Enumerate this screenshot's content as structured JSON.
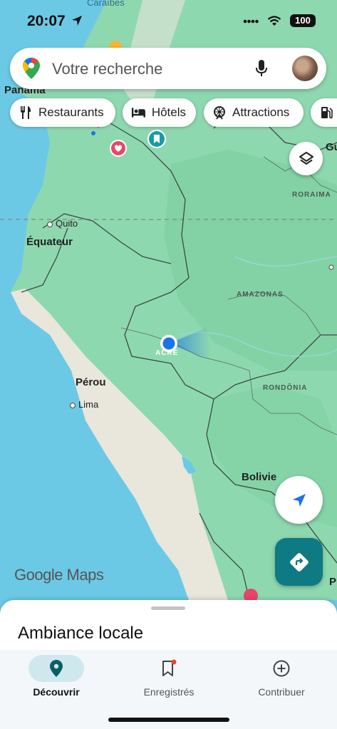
{
  "status": {
    "time": "20:07",
    "battery": "100"
  },
  "search": {
    "placeholder": "Votre recherche"
  },
  "chips": [
    {
      "label": "Restaurants",
      "icon": "restaurant-icon"
    },
    {
      "label": "Hôtels",
      "icon": "hotel-bed-icon"
    },
    {
      "label": "Attractions",
      "icon": "attraction-icon"
    },
    {
      "label": "",
      "icon": "gas-station-icon"
    }
  ],
  "map": {
    "labels": {
      "caraibes": "Caraïbes",
      "panama": "Panama",
      "quito": "Quito",
      "equateur": "Équateur",
      "perou": "Pérou",
      "lima": "Lima",
      "bolivie": "Bolivie",
      "roraima": "RORAIMA",
      "amazonas": "AMAZONAS",
      "rondonia": "RONDÔNIA",
      "acre": "ACRE",
      "gu": "Gu",
      "p": "P"
    },
    "attribution": "Google Maps"
  },
  "sheet": {
    "title": "Ambiance locale"
  },
  "nav": {
    "discover": "Découvrir",
    "saved": "Enregistrés",
    "contribute": "Contribuer"
  },
  "colors": {
    "land": "#8ed8b0",
    "water": "#6cc9e6",
    "teal": "#0e7a84",
    "location": "#1a73e8"
  }
}
